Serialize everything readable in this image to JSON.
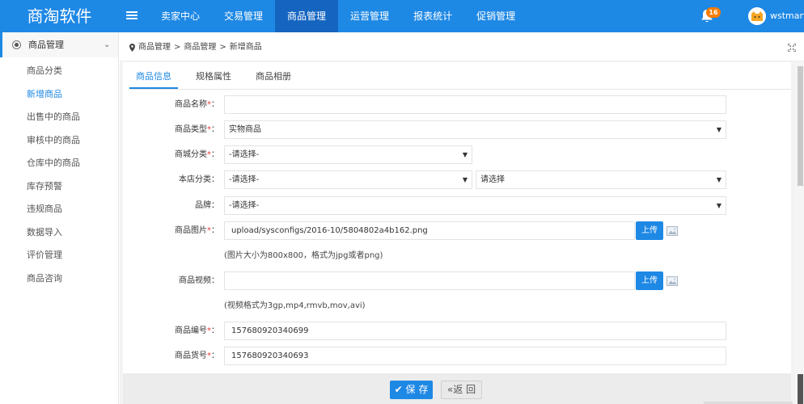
{
  "app": {
    "logo": "商淘软件",
    "username": "wstmart",
    "notifications": "16"
  },
  "nav": [
    "卖家中心",
    "交易管理",
    "商品管理",
    "运营管理",
    "报表统计",
    "促销管理"
  ],
  "sidebar": {
    "header": "商品管理",
    "items": [
      "商品分类",
      "新增商品",
      "出售中的商品",
      "审核中的商品",
      "仓库中的商品",
      "库存预警",
      "违规商品",
      "数据导入",
      "评价管理",
      "商品咨询"
    ]
  },
  "breadcrumb": {
    "a": "商品管理",
    "sep": ">",
    "b": "商品管理",
    "c": "新增商品"
  },
  "tabs": [
    "商品信息",
    "规格属性",
    "商品相册"
  ],
  "form": {
    "name_label": "商品名称",
    "name_value": "",
    "type_label": "商品类型",
    "type_value": "实物商品",
    "mall_cat_label": "商城分类",
    "mall_cat_value": "-请选择-",
    "shop_cat_label": "本店分类",
    "shop_cat_value": "-请选择-",
    "shop_cat_value2": "请选择",
    "brand_label": "品牌",
    "brand_value": "-请选择-",
    "image_label": "商品图片",
    "image_value": "upload/sysconfigs/2016-10/5804802a4b162.png",
    "image_hint": "(图片大小为800x800，格式为jpg或者png)",
    "video_label": "商品视频",
    "video_value": "",
    "video_hint": "(视频格式为3gp,mp4,rmvb,mov,avi)",
    "sn_label": "商品编号",
    "sn_value": "157680920340699",
    "product_no_label": "商品货号",
    "product_no_value": "157680920340693",
    "upload_label": "上传",
    "colon": "：",
    "star": "*"
  },
  "buttons": {
    "save": "保 存",
    "back": "«返 回"
  },
  "colors": {
    "primary": "#1e88e5",
    "nav_active": "#1565c0",
    "badge": "#f57c00"
  }
}
